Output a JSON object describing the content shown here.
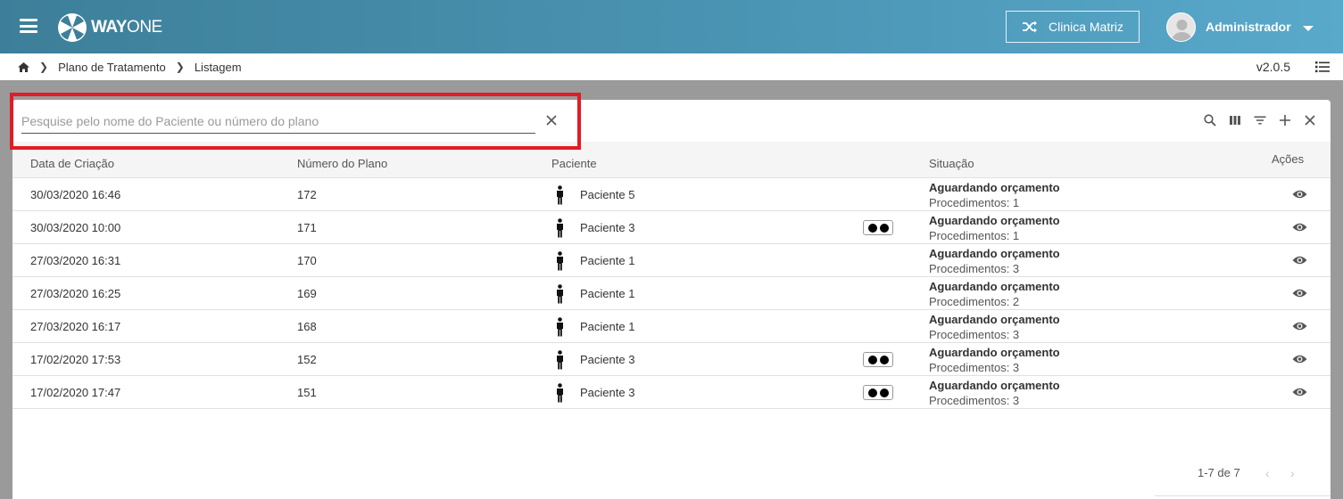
{
  "header": {
    "logo_text_bold": "WAY",
    "logo_text_light": "ONE",
    "clinic_label": "Clinica Matriz",
    "user_name": "Administrador"
  },
  "breadcrumb": {
    "items": [
      "Plano de Tratamento",
      "Listagem"
    ],
    "version": "v2.0.5"
  },
  "search": {
    "placeholder": "Pesquise pelo nome do Paciente ou número do plano",
    "value": ""
  },
  "table": {
    "columns": [
      "Data de Criação",
      "Número do Plano",
      "Paciente",
      "Situação",
      "Ações"
    ],
    "rows": [
      {
        "date": "30/03/2020 16:46",
        "plan": "172",
        "patient": "Paciente 5",
        "badge": false,
        "status": "Aguardando orçamento",
        "procedures": "Procedimentos: 1"
      },
      {
        "date": "30/03/2020 10:00",
        "plan": "171",
        "patient": "Paciente 3",
        "badge": true,
        "status": "Aguardando orçamento",
        "procedures": "Procedimentos: 1"
      },
      {
        "date": "27/03/2020 16:31",
        "plan": "170",
        "patient": "Paciente 1",
        "badge": false,
        "status": "Aguardando orçamento",
        "procedures": "Procedimentos: 3"
      },
      {
        "date": "27/03/2020 16:25",
        "plan": "169",
        "patient": "Paciente 1",
        "badge": false,
        "status": "Aguardando orçamento",
        "procedures": "Procedimentos: 2"
      },
      {
        "date": "27/03/2020 16:17",
        "plan": "168",
        "patient": "Paciente 1",
        "badge": false,
        "status": "Aguardando orçamento",
        "procedures": "Procedimentos: 3"
      },
      {
        "date": "17/02/2020 17:53",
        "plan": "152",
        "patient": "Paciente 3",
        "badge": true,
        "status": "Aguardando orçamento",
        "procedures": "Procedimentos: 3"
      },
      {
        "date": "17/02/2020 17:47",
        "plan": "151",
        "patient": "Paciente 3",
        "badge": true,
        "status": "Aguardando orçamento",
        "procedures": "Procedimentos: 3"
      }
    ]
  },
  "pagination": {
    "range": "1-7 de 7"
  },
  "colors": {
    "topbar": "#4a94b3",
    "highlight": "#e31b23"
  }
}
